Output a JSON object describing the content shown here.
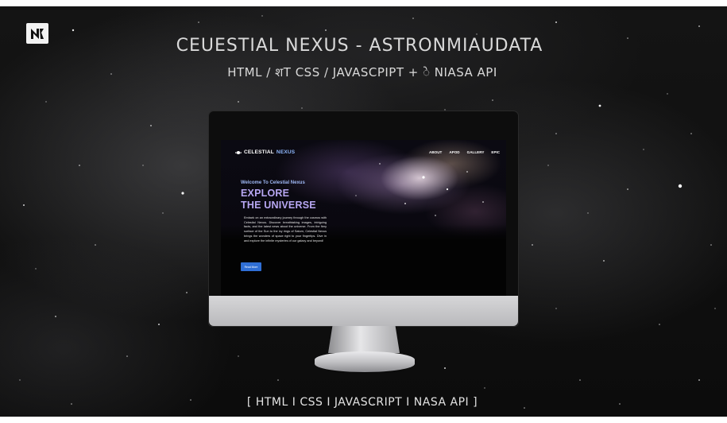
{
  "banner": {
    "title": "CEUESTIAL NEXUS - ASTRONMIAUDATA",
    "subtitle": "HTML / शT CSS / JAVASCPIPT + े NIASA API",
    "footer": "[ HTML I CSS I JAVASCRIPT I NASA API ]",
    "logo_icon": "nr-logo-icon"
  },
  "website": {
    "brand_prefix": "CELESTIAL",
    "brand_suffix": "NEXUS",
    "brand_icon": "planet-icon",
    "nav": [
      "ABOUT",
      "APOD",
      "GALLERY",
      "EPIC"
    ],
    "kicker": "Welcome To Celestial Nexus",
    "headline_line1": "EXPLORE",
    "headline_line2": "THE UNIVERSE",
    "body": "Embark on an extraordinary journey through the cosmos with Celestial Nexus. Discover breathtaking images, intriguing facts, and the latest news about the universe. From the fiery surface of the Sun to the icy rings of Saturn, Celestial Nexus brings the wonders of space right to your fingertips. Dive in and explore the infinite mysteries of our galaxy and beyond!",
    "button_label": "Read More"
  },
  "colors": {
    "accent_blue": "#2f6fd6",
    "headline_violet": "#b7a7f2",
    "kicker_blue": "#9fb8f5"
  }
}
